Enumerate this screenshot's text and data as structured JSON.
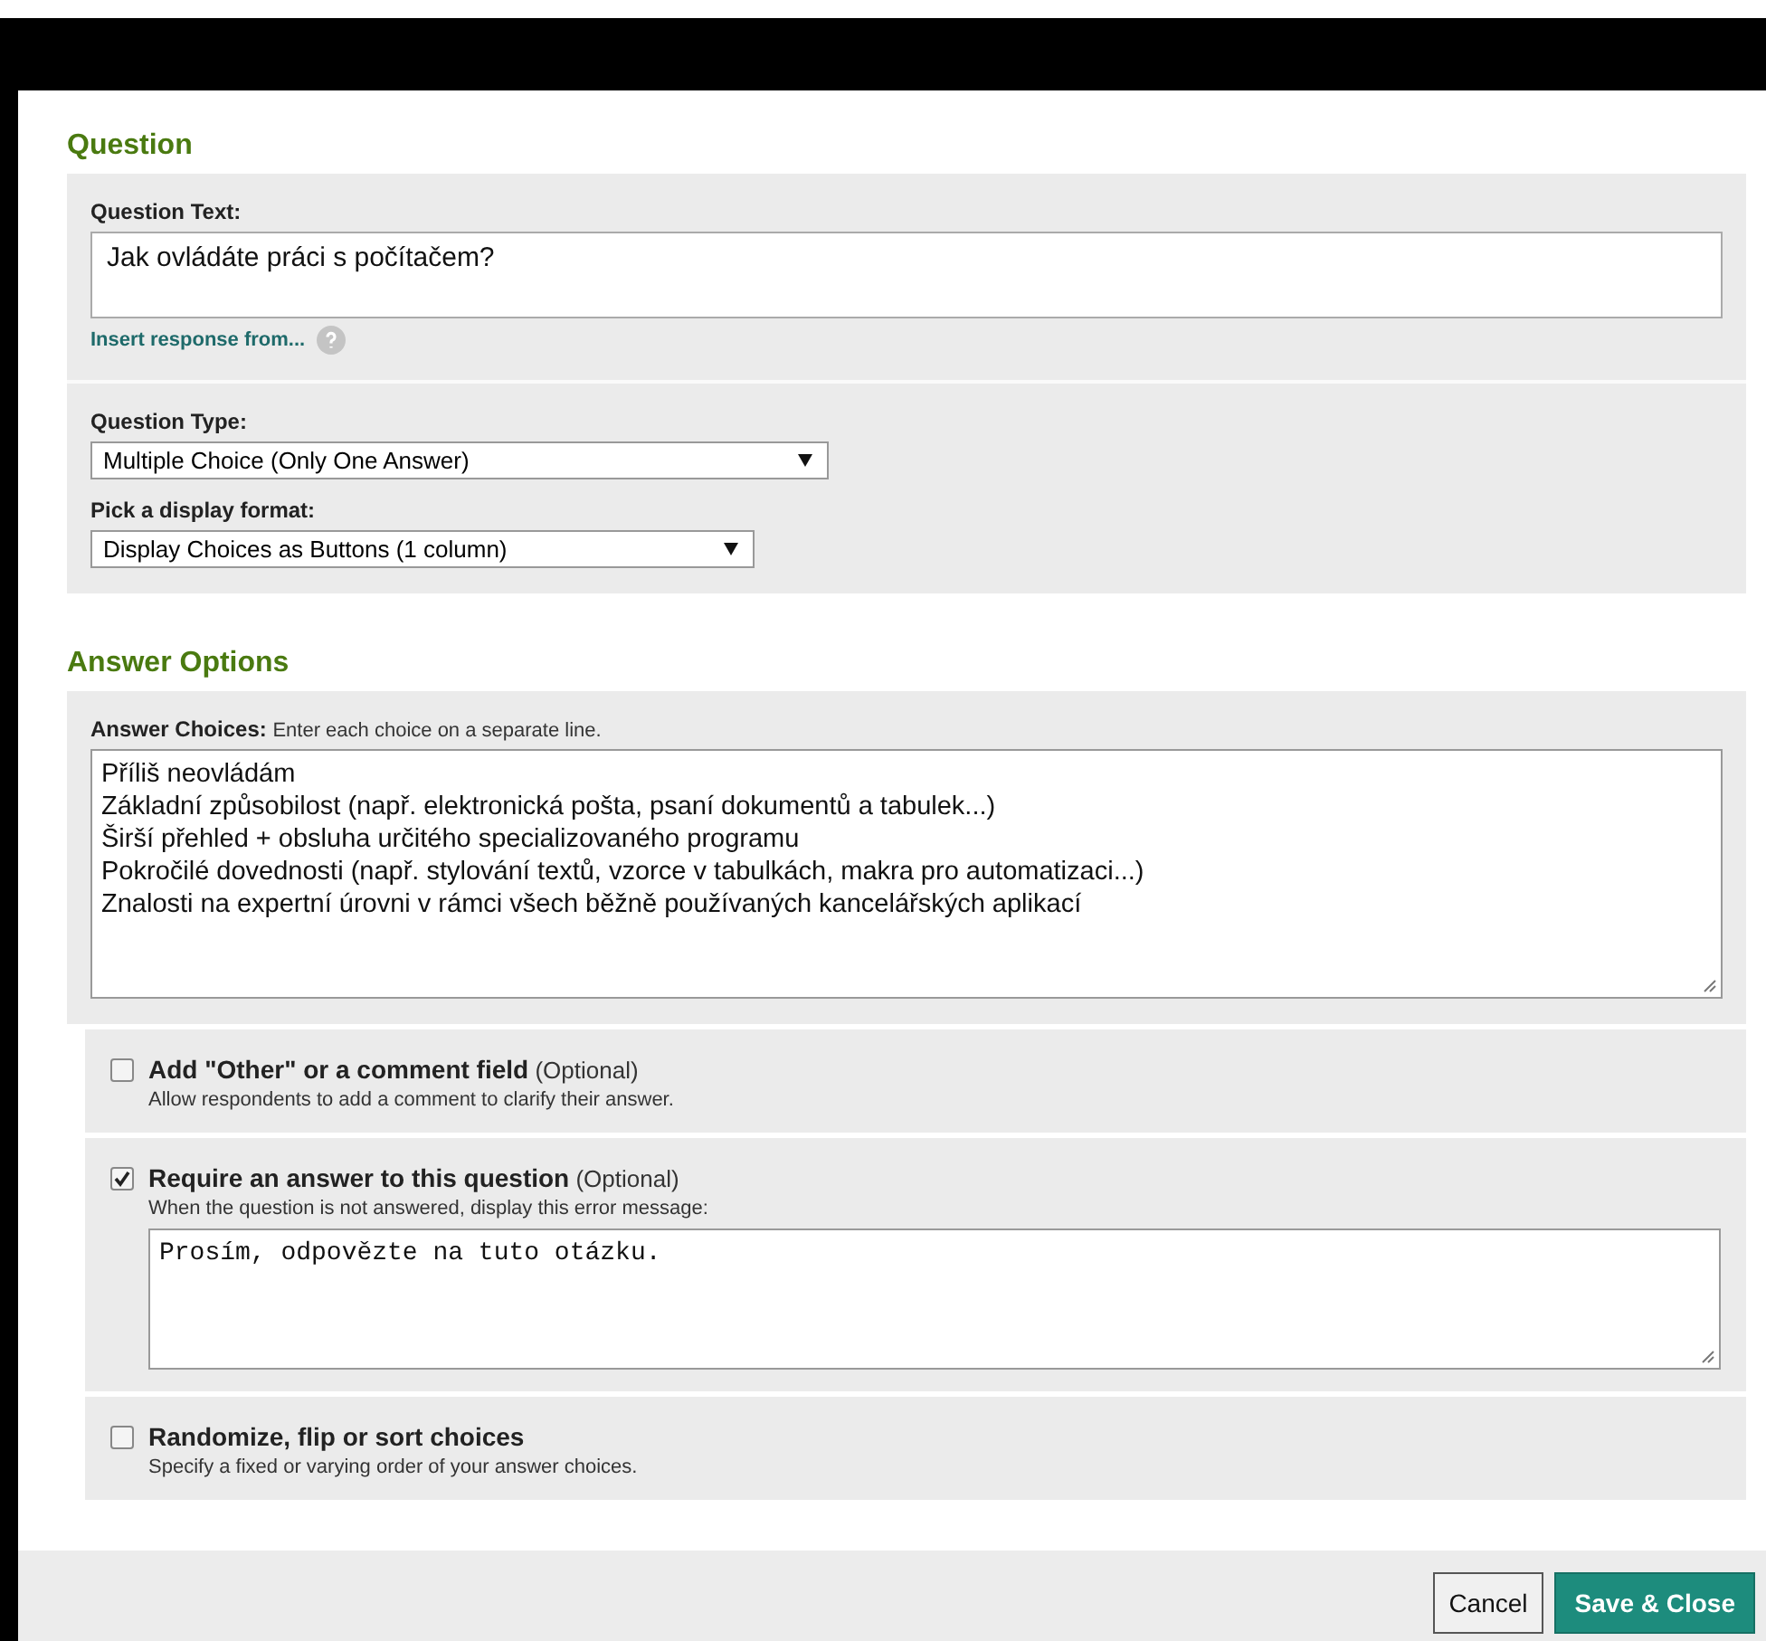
{
  "question": {
    "heading": "Question",
    "text_label": "Question Text:",
    "text_value": "Jak ovládáte práci s počítačem?",
    "insert_link": "Insert response from...",
    "type_label": "Question Type:",
    "type_value": "Multiple Choice (Only One Answer)",
    "format_label": "Pick a display format:",
    "format_value": "Display Choices as Buttons (1 column)"
  },
  "answers": {
    "heading": "Answer Options",
    "choices_label": "Answer Choices:",
    "choices_hint": "Enter each choice on a separate line.",
    "choices": [
      "Příliš neovládám",
      "Základní způsobilost (např. elektronická pošta, psaní dokumentů a tabulek...)",
      "Širší přehled + obsluha určitého specializovaného programu",
      "Pokročilé dovednosti (např. stylování textů, vzorce v tabulkách, makra pro automatizaci...)",
      "Znalosti na expertní úrovni v rámci všech běžně používaných kancelářských aplikací"
    ]
  },
  "options": [
    {
      "label": "Add \"Other\" or a comment field",
      "optional": "(Optional)",
      "hint": "Allow respondents to add a comment to clarify their answer.",
      "checked": false
    },
    {
      "label": "Require an answer to this question",
      "optional": "(Optional)",
      "hint": "When the question is not answered, display this error message:",
      "checked": true,
      "message": "Prosím, odpovězte na tuto otázku."
    },
    {
      "label": "Randomize, flip or sort choices",
      "hint": "Specify a fixed or varying order of your answer choices.",
      "checked": false
    }
  ],
  "buttons": [
    {
      "label": "Cancel",
      "kind": "secondary"
    },
    {
      "label": "Save & Close",
      "kind": "primary"
    }
  ]
}
